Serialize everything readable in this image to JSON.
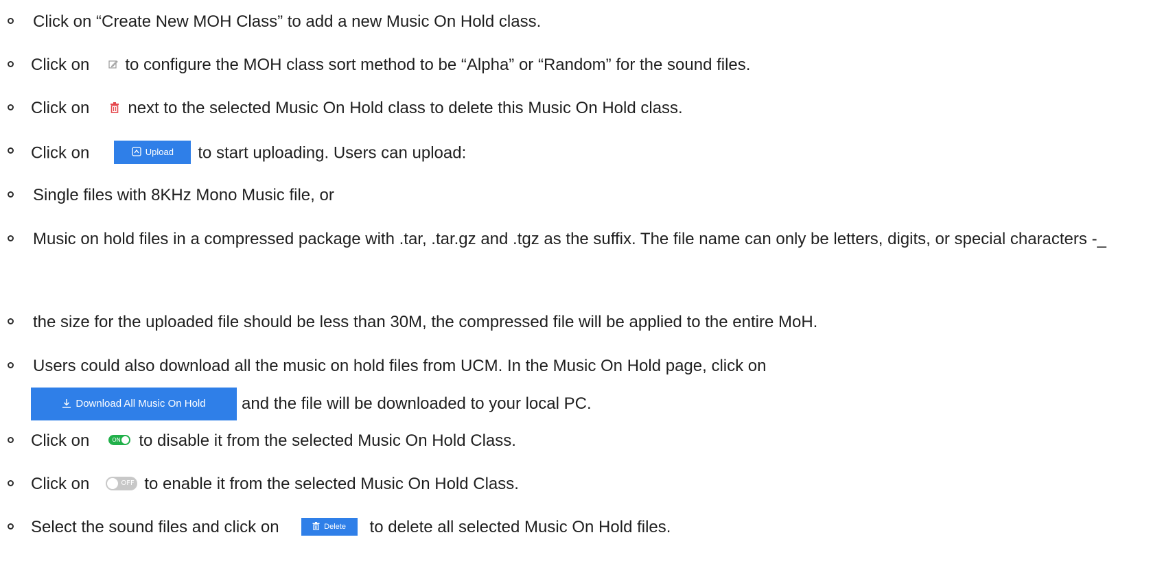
{
  "items": [
    {
      "text": "Click on “Create New MOH Class” to add a new Music On Hold class."
    },
    {
      "before": "Click on",
      "after": "to configure the MOH class sort method to be “Alpha” or “Random” for the sound files.",
      "icon": "edit-icon"
    },
    {
      "before": "Click on",
      "after": "next to the selected Music On Hold class to delete this Music On Hold class.",
      "icon": "trash-icon"
    },
    {
      "before": "Click on",
      "button": "Upload",
      "after": "to start uploading. Users can upload:"
    },
    {
      "text": "Single files with 8KHz Mono Music file, or"
    },
    {
      "text": "Music on hold files in a compressed package with .tar, .tar.gz and .tgz as the suffix. The file name can only be letters, digits, or special characters -_"
    },
    {
      "text": "the size for the uploaded file should be less than 30M, the compressed file will be applied to the entire MoH."
    },
    {
      "text": "Users could also download all the music on hold files from UCM. In the Music On Hold page, click on",
      "button": "Download All Music On Hold",
      "after": "and the file will be downloaded to your local PC."
    },
    {
      "before": "Click on",
      "toggle": "ON",
      "after": "to disable it from the selected Music On Hold Class."
    },
    {
      "before": "Click on",
      "toggle": "OFF",
      "after": "to enable it from the selected Music On Hold Class."
    },
    {
      "before": "Select the sound files and click on",
      "button": "Delete",
      "after": "to delete all selected Music On Hold files."
    }
  ],
  "colors": {
    "button_blue": "#2f7fe8",
    "toggle_on": "#21b04a",
    "toggle_off": "#c8c8c8",
    "trash_red": "#e5484d",
    "edit_gray": "#9a9a9a"
  }
}
